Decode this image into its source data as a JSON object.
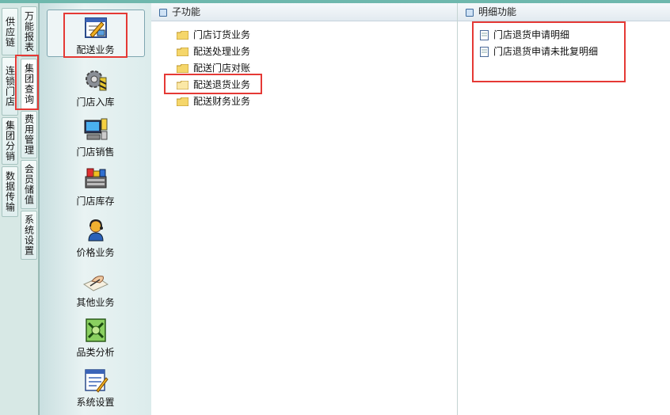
{
  "left_tabs_outer": [
    "供应链",
    "连锁门店",
    "集团分销",
    "数据传输"
  ],
  "left_tabs_inner": [
    "万能报表",
    "集团查询",
    "费用管理",
    "会员储值",
    "系统设置"
  ],
  "nav_items": [
    {
      "label": "配送业务",
      "icon": "delivery-form-icon"
    },
    {
      "label": "门店入库",
      "icon": "gear-warehouse-icon"
    },
    {
      "label": "门店销售",
      "icon": "pos-terminal-icon"
    },
    {
      "label": "门店库存",
      "icon": "cash-register-icon"
    },
    {
      "label": "价格业务",
      "icon": "person-support-icon"
    },
    {
      "label": "其他业务",
      "icon": "hand-writing-icon"
    },
    {
      "label": "品类分析",
      "icon": "money-chart-icon"
    },
    {
      "label": "系统设置",
      "icon": "settings-form-icon"
    }
  ],
  "subfunctions": {
    "title": "子功能",
    "items": [
      "门店订货业务",
      "配送处理业务",
      "配送门店对账",
      "配送退货业务",
      "配送财务业务"
    ]
  },
  "details": {
    "title": "明细功能",
    "items": [
      "门店退货申请明细",
      "门店退货申请未批复明细"
    ]
  }
}
